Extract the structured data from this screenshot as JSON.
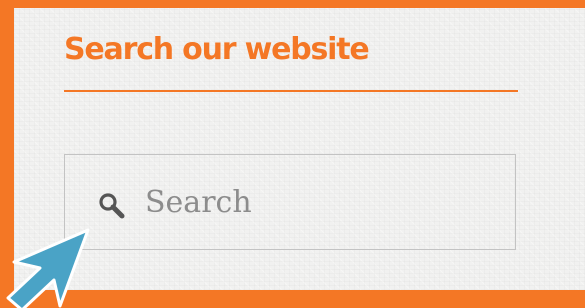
{
  "widget": {
    "title": "Search our website"
  },
  "search": {
    "placeholder": "Search",
    "value": ""
  },
  "colors": {
    "accent": "#f47725",
    "panel_background": "#f1f1f0",
    "input_border": "#c3c3c3",
    "placeholder_text": "#8c8c8c",
    "icon": "#555555",
    "cursor_arrow": "#4aa3c6"
  },
  "icons": {
    "search": "magnifying-glass",
    "cursor": "arrow-pointer"
  }
}
